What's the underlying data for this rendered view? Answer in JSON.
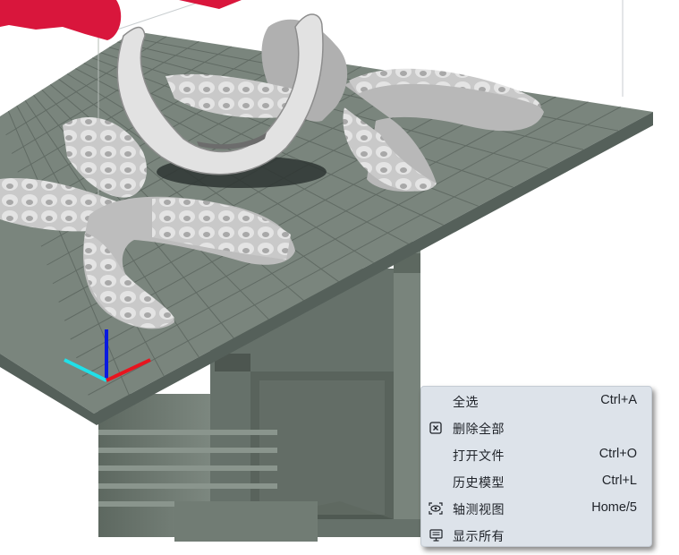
{
  "scene": {
    "background_color": "#ffffff",
    "plate_color": "#6e7a72",
    "model_color": "#c8c8c8",
    "support_color": "#e0213e",
    "axis_colors": {
      "x": "#e8141e",
      "y": "#20e0e8",
      "z": "#0a1ae0"
    }
  },
  "context_menu": {
    "items": [
      {
        "label": "全选",
        "shortcut": "Ctrl+A",
        "icon": ""
      },
      {
        "label": "删除全部",
        "shortcut": "",
        "icon": "delete-box-icon"
      },
      {
        "label": "打开文件",
        "shortcut": "Ctrl+O",
        "icon": ""
      },
      {
        "label": "历史模型",
        "shortcut": "Ctrl+L",
        "icon": ""
      },
      {
        "label": "轴测视图",
        "shortcut": "Home/5",
        "icon": "eye-view-icon"
      },
      {
        "label": "显示所有",
        "shortcut": "",
        "icon": "monitor-icon"
      }
    ]
  }
}
